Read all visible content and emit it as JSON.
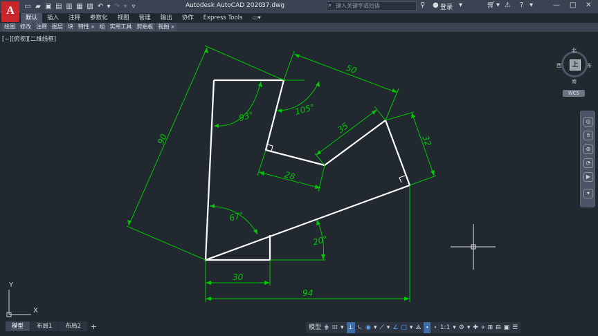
{
  "app": {
    "logo_letter": "A",
    "title": "Autodesk AutoCAD 2020",
    "file": "37.dwg"
  },
  "search": {
    "placeholder": "键入关键字或短语"
  },
  "user": {
    "login_label": "登录"
  },
  "ribbon_tabs": [
    "默认",
    "插入",
    "注释",
    "参数化",
    "视图",
    "管理",
    "输出",
    "协作",
    "Express Tools"
  ],
  "ribbon_panels": [
    "绘图",
    "修改",
    "注释",
    "图层",
    "块",
    "特性 »",
    "组",
    "实用工具",
    "剪贴板",
    "视图 »"
  ],
  "viewport": {
    "label": "[−][俯视][二维线框]"
  },
  "dimensions": {
    "d90": "90",
    "d50": "50",
    "d35": "35",
    "d32": "32",
    "d28": "28",
    "d30": "30",
    "d94": "94",
    "a93": "93°",
    "a105": "105°",
    "a67": "67°",
    "a20": "20°"
  },
  "viewcube": {
    "top": "上",
    "north": "北",
    "south": "南",
    "west": "西",
    "east": "东",
    "wcs": "WCS"
  },
  "ucs": {
    "x": "X",
    "y": "Y"
  },
  "layout_tabs": [
    "模型",
    "布局1",
    "布局2"
  ],
  "add_tab_symbol": "+",
  "status": {
    "model_label": "模型",
    "scale": "1:1"
  },
  "colors": {
    "canvas": "#212830",
    "geometry": "#ffffff",
    "dimension": "#00c800",
    "titlebar": "#3a4352"
  }
}
